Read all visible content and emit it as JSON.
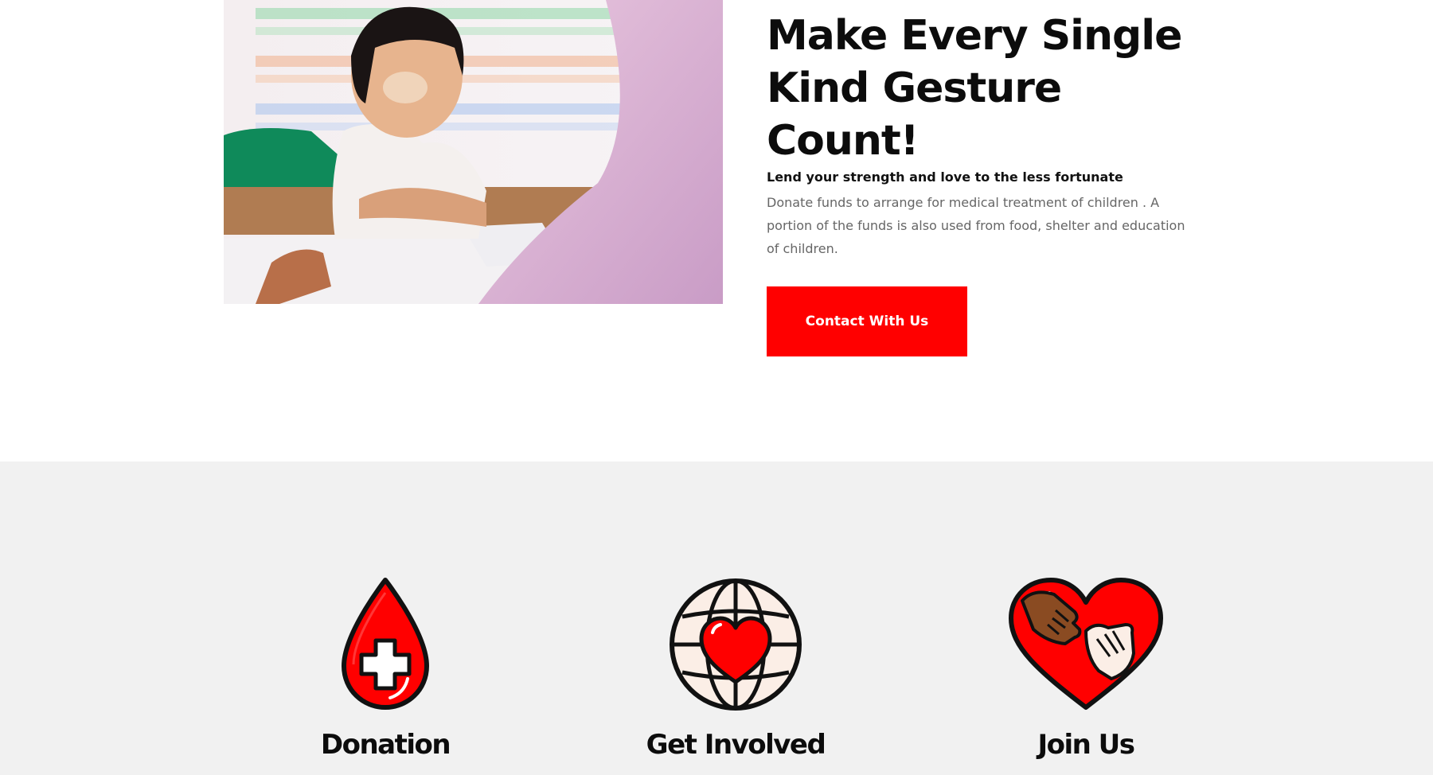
{
  "hero": {
    "headline_line1": "Make Every Single",
    "headline_line2": "Kind Gesture Count!",
    "subhead": "Lend your strength and love to the less fortunate",
    "body": "Donate funds to arrange for medical treatment of children . A portion of the funds is also used from food, shelter and education of children.",
    "cta_label": "Contact With Us",
    "photo_icon": "child-studying-photo"
  },
  "features": [
    {
      "icon": "blood-drop-cross-icon",
      "title": "Donation"
    },
    {
      "icon": "globe-heart-icon",
      "title": "Get Involved"
    },
    {
      "icon": "heart-hands-icon",
      "title": "Join Us"
    }
  ],
  "colors": {
    "accent": "#ff0000",
    "section_bg": "#f1f1f1",
    "heading": "#0c0c0c",
    "body_text": "#666666"
  }
}
